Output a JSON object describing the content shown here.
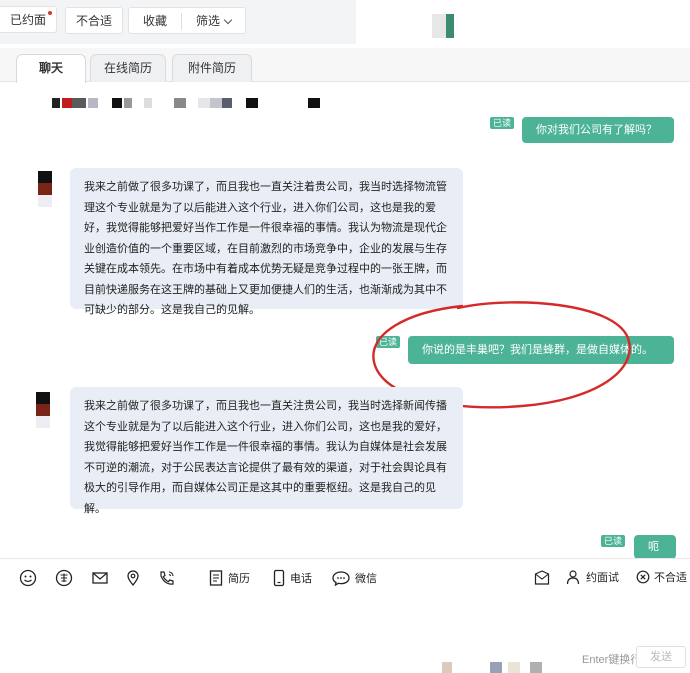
{
  "filters": {
    "contacted": "已约面",
    "unfit": "不合适",
    "favorite": "收藏",
    "filter": "筛选"
  },
  "tabs": [
    "聊天",
    "在线简历",
    "附件简历"
  ],
  "messages": [
    {
      "side": "right",
      "status": "已读",
      "text": "你对我们公司有了解吗？"
    },
    {
      "side": "left",
      "text": "我来之前做了很多功课了，而且我也一直关注着贵公司，我当时选择物流管理这个专业就是为了以后能进入这个行业，进入你们公司，这也是我的爱好，我觉得能够把爱好当作工作是一件很幸福的事情。我认为物流是现代企业创造价值的一个重要区域，在目前激烈的市场竞争中，企业的发展与生存关键在成本领先。在市场中有着成本优势无疑是竞争过程中的一张王牌，而目前快递服务在这王牌的基础上又更加便捷人们的生活，也渐渐成为其中不可缺少的部分。这是我自己的见解。"
    },
    {
      "side": "right",
      "status": "已读",
      "text": "你说的是丰巢吧？我们是蜂群，是做自媒体的。"
    },
    {
      "side": "left",
      "text": "我来之前做了很多功课了，而且我也一直关注贵公司，我当时选择新闻传播这个专业就是为了以后能进入这个行业，进入你们公司，这也是我的爱好，我觉得能够把爱好当作工作是一件很幸福的事情。我认为自媒体是社会发展不可逆的潮流，对于公民表达言论提供了最有效的渠道，对于社会舆论具有极大的引导作用，而自媒体公司正是这其中的重要枢纽。这是我自己的见解。"
    },
    {
      "side": "right",
      "status": "已读",
      "text": "呃"
    }
  ],
  "toolbar": {
    "resume": "简历",
    "phone": "电话",
    "wechat": "微信",
    "interview": "约面试",
    "unfit": "不合适"
  },
  "composer": {
    "hint": "Enter键换行",
    "send": "发送"
  },
  "colors": {
    "accent": "#4db396",
    "bubble_left": "#e9edf5",
    "annotation": "#d42a2a"
  },
  "icons": [
    "emoji-icon",
    "common-phrase-icon",
    "mail-icon",
    "location-icon",
    "call-icon",
    "resume-icon",
    "phone-icon",
    "wechat-icon",
    "inbox-icon",
    "interview-icon",
    "unfit-icon"
  ]
}
